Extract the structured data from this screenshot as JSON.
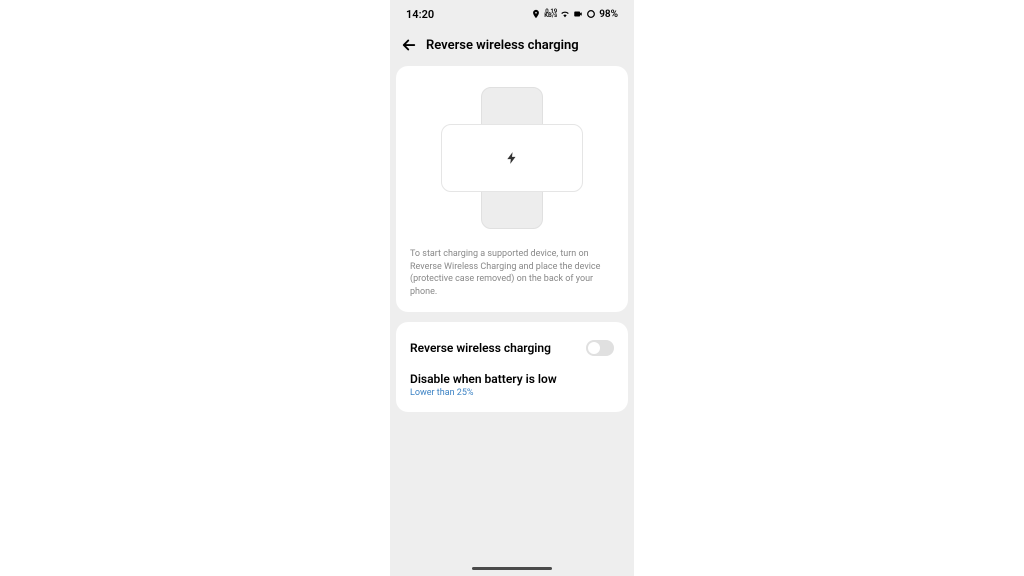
{
  "statusBar": {
    "time": "14:20",
    "speedTop": "0.19",
    "speedBottom": "KB/s",
    "battery": "98%"
  },
  "header": {
    "title": "Reverse wireless charging"
  },
  "card1": {
    "instruction": "To start charging a supported device, turn on Reverse Wireless Charging and place the device (protective case removed) on the back of your phone."
  },
  "card2": {
    "toggleLabel": "Reverse wireless charging",
    "disableLabel": "Disable when battery is low",
    "disableValue": "Lower than 25%"
  }
}
